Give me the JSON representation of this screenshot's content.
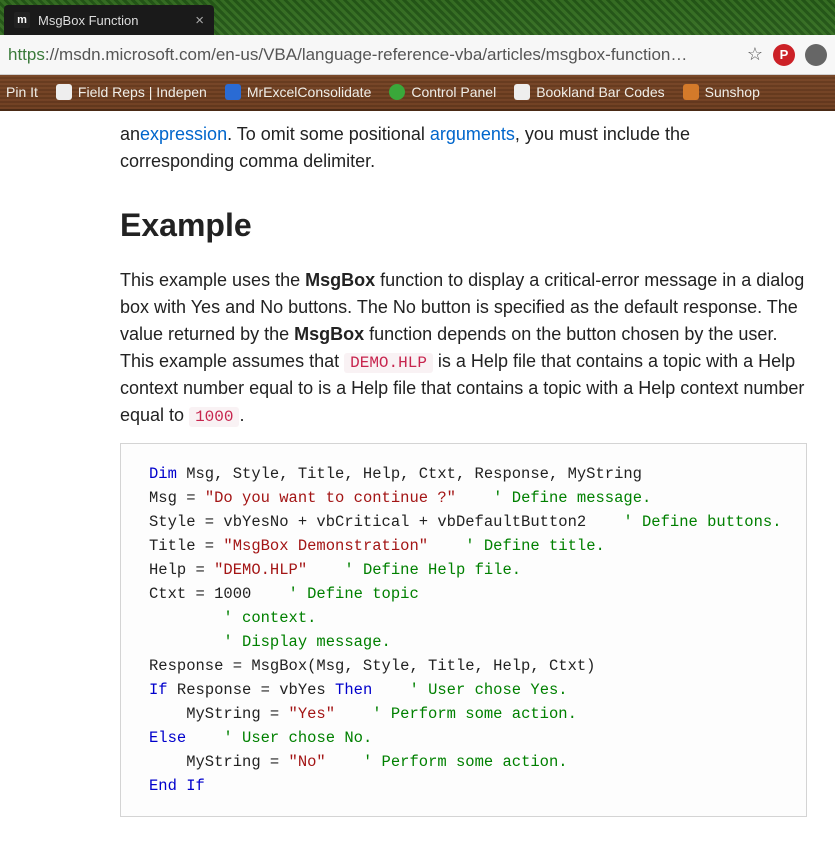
{
  "tab": {
    "favicon_letter": "m",
    "title": "MsgBox Function",
    "close": "×"
  },
  "address": {
    "scheme": "https",
    "rest": "://msdn.microsoft.com/en-us/VBA/language-reference-vba/articles/msgbox-function…"
  },
  "toolbar_icons": {
    "star": "☆",
    "pin_glyph": "P"
  },
  "bookmarks": {
    "b0": "Pin It",
    "b1": "Field Reps | Indepen",
    "b2": "MrExcelConsolidate",
    "b3": "Control Panel",
    "b4": "Bookland Bar Codes",
    "b5": "Sunshop"
  },
  "article": {
    "intro_prefix": "an",
    "link_expression": "expression",
    "intro_mid": ". To omit some positional ",
    "link_arguments": "arguments",
    "intro_suffix": ", you must include the corresponding comma delimiter.",
    "heading": "Example",
    "p2_a": "This example uses the ",
    "p2_b": "MsgBox",
    "p2_c": " function to display a critical-error message in a dialog box with Yes and No buttons. The No button is specified as the default response. The value returned by the ",
    "p2_d": "MsgBox",
    "p2_e": " function depends on the button chosen by the user. This example assumes that ",
    "code_demo": "DEMO.HLP",
    "p2_f": " is a Help file that contains a topic with a Help context number equal to is a Help file that contains a topic with a Help context number equal to ",
    "code_1000": "1000",
    "p2_g": "."
  },
  "code": {
    "l1_kw": "Dim",
    "l1_rest": " Msg, Style, Title, Help, Ctxt, Response, MyString",
    "l2_a": "Msg = ",
    "l2_str": "\"Do you want to continue ?\"",
    "l2_com": "    ' Define message.",
    "l3_a": "Style = vbYesNo + vbCritical + vbDefaultButton2    ",
    "l3_com": "' Define buttons.",
    "l4_a": "Title = ",
    "l4_str": "\"MsgBox Demonstration\"",
    "l4_com": "    ' Define title.",
    "l5_a": "Help = ",
    "l5_str": "\"DEMO.HLP\"",
    "l5_com": "    ' Define Help file.",
    "l6_a": "Ctxt = 1000    ",
    "l6_com": "' Define topic",
    "l7_com": "        ' context.",
    "l8_com": "        ' Display message.",
    "l9": "Response = MsgBox(Msg, Style, Title, Help, Ctxt)",
    "l10_kw1": "If",
    "l10_mid": " Response = vbYes ",
    "l10_kw2": "Then",
    "l10_com": "    ' User chose Yes.",
    "l11_a": "    MyString = ",
    "l11_str": "\"Yes\"",
    "l11_com": "    ' Perform some action.",
    "l12_kw": "Else",
    "l12_com": "    ' User chose No.",
    "l13_a": "    MyString = ",
    "l13_str": "\"No\"",
    "l13_com": "    ' Perform some action.",
    "l14_kw": "End If"
  }
}
